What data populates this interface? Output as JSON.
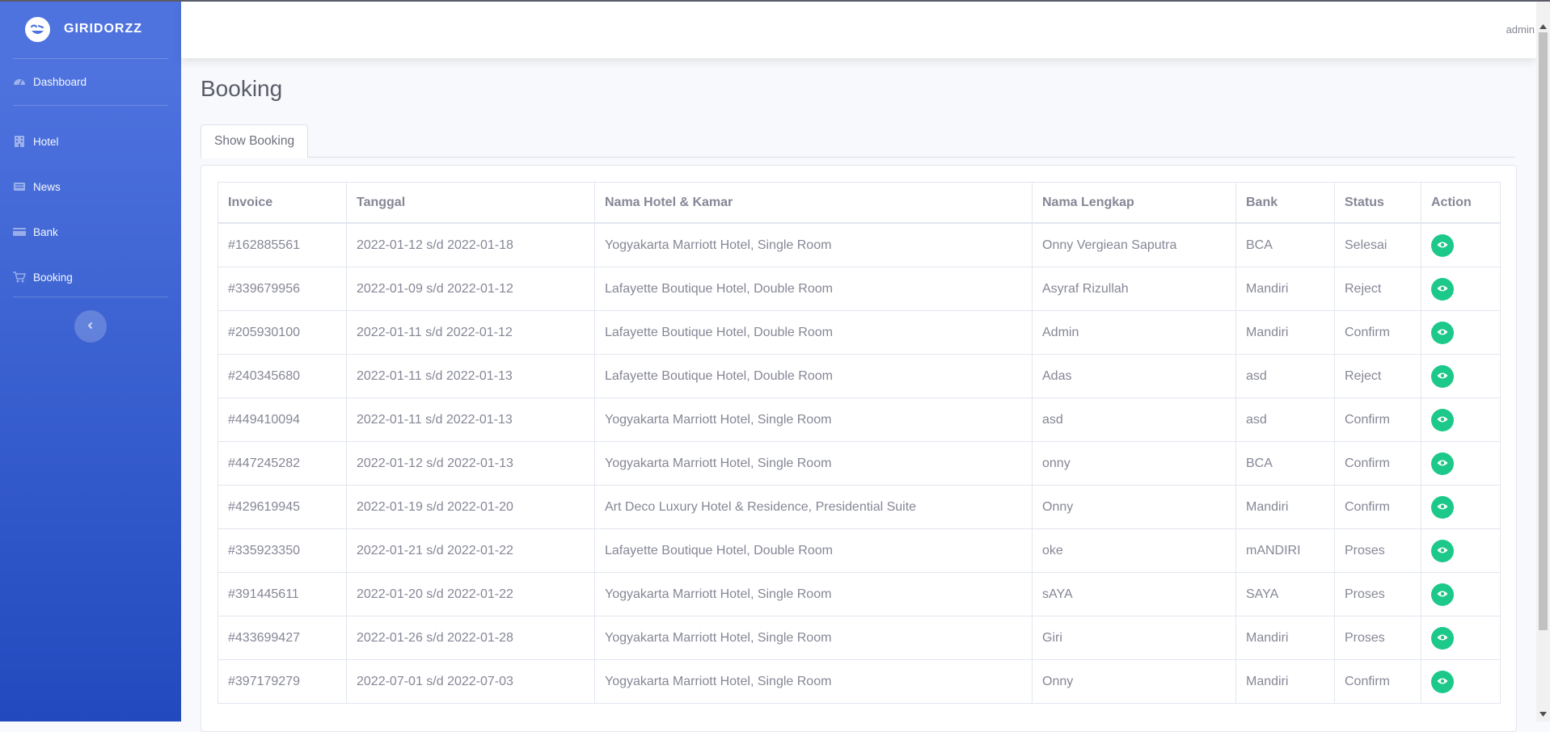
{
  "brand": {
    "name": "GIRIDORZZ"
  },
  "sidebar": {
    "items": [
      {
        "label": "Dashboard",
        "icon": "tachometer-icon"
      },
      {
        "label": "Hotel",
        "icon": "hotel-icon"
      },
      {
        "label": "News",
        "icon": "news-icon"
      },
      {
        "label": "Bank",
        "icon": "card-icon"
      },
      {
        "label": "Booking",
        "icon": "cart-icon"
      }
    ]
  },
  "topbar": {
    "user": "admin"
  },
  "page": {
    "title": "Booking",
    "tab": "Show Booking"
  },
  "table": {
    "headers": [
      "Invoice",
      "Tanggal",
      "Nama Hotel & Kamar",
      "Nama Lengkap",
      "Bank",
      "Status",
      "Action"
    ],
    "rows": [
      [
        "#162885561",
        "2022-01-12 s/d 2022-01-18",
        "Yogyakarta Marriott Hotel, Single Room",
        "Onny Vergiean Saputra",
        "BCA",
        "Selesai"
      ],
      [
        "#339679956",
        "2022-01-09 s/d 2022-01-12",
        "Lafayette Boutique Hotel, Double Room",
        "Asyraf Rizullah",
        "Mandiri",
        "Reject"
      ],
      [
        "#205930100",
        "2022-01-11 s/d 2022-01-12",
        "Lafayette Boutique Hotel, Double Room",
        "Admin",
        "Mandiri",
        "Confirm"
      ],
      [
        "#240345680",
        "2022-01-11 s/d 2022-01-13",
        "Lafayette Boutique Hotel, Double Room",
        "Adas",
        "asd",
        "Reject"
      ],
      [
        "#449410094",
        "2022-01-11 s/d 2022-01-13",
        "Yogyakarta Marriott Hotel, Single Room",
        "asd",
        "asd",
        "Confirm"
      ],
      [
        "#447245282",
        "2022-01-12 s/d 2022-01-13",
        "Yogyakarta Marriott Hotel, Single Room",
        "onny",
        "BCA",
        "Confirm"
      ],
      [
        "#429619945",
        "2022-01-19 s/d 2022-01-20",
        "Art Deco Luxury Hotel & Residence, Presidential Suite",
        "Onny",
        "Mandiri",
        "Confirm"
      ],
      [
        "#335923350",
        "2022-01-21 s/d 2022-01-22",
        "Lafayette Boutique Hotel, Double Room",
        "oke",
        "mANDIRI",
        "Proses"
      ],
      [
        "#391445611",
        "2022-01-20 s/d 2022-01-22",
        "Yogyakarta Marriott Hotel, Single Room",
        "sAYA",
        "SAYA",
        "Proses"
      ],
      [
        "#433699427",
        "2022-01-26 s/d 2022-01-28",
        "Yogyakarta Marriott Hotel, Single Room",
        "Giri",
        "Mandiri",
        "Proses"
      ],
      [
        "#397179279",
        "2022-07-01 s/d 2022-07-03",
        "Yogyakarta Marriott Hotel, Single Room",
        "Onny",
        "Mandiri",
        "Confirm"
      ]
    ],
    "action_icon": "eye-icon"
  },
  "colors": {
    "sidebar_top": "#4e73df",
    "sidebar_bottom": "#224abe",
    "action": "#1cc88a",
    "text": "#858796"
  }
}
